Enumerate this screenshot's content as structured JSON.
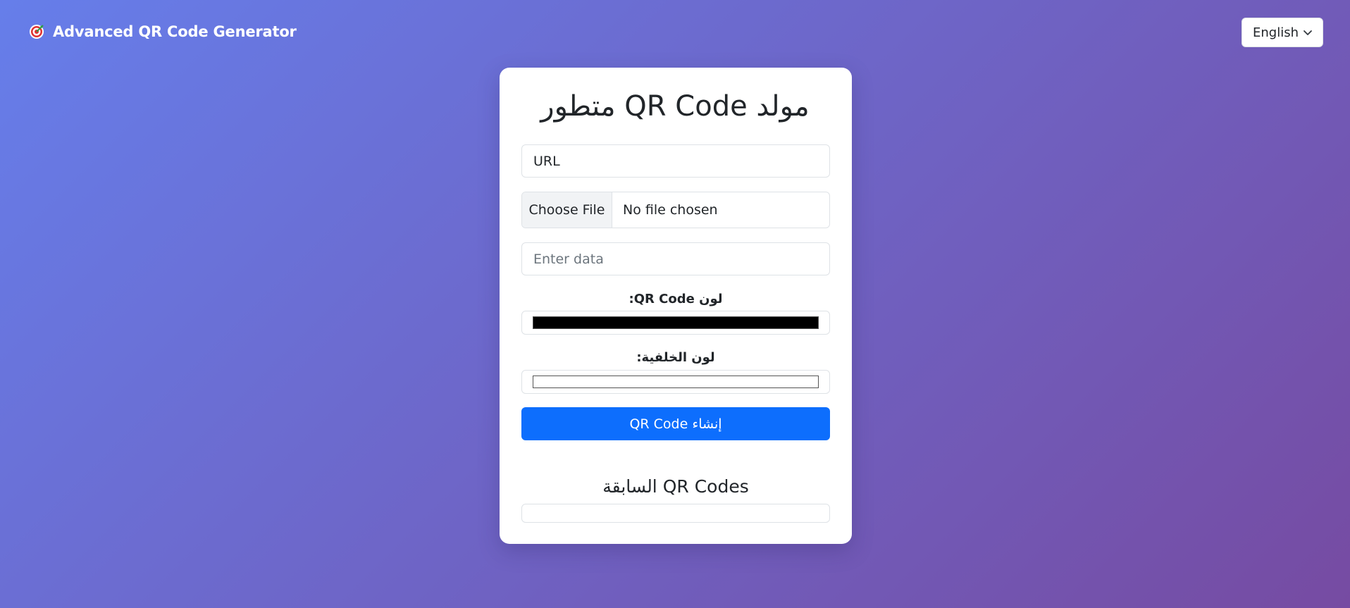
{
  "header": {
    "brand_icon": "target-icon",
    "brand_text": "Advanced QR Code Generator",
    "language_selected": "English"
  },
  "form": {
    "title": "مولد QR Code متطور",
    "url_value": "URL",
    "file_button_label": "Choose File",
    "file_status": "No file chosen",
    "data_placeholder": "Enter data",
    "qr_color_label": "لون QR Code:",
    "qr_color_value": "#000000",
    "bg_color_label": "لون الخلفية:",
    "bg_color_value": "#ffffff",
    "generate_label": "إنشاء QR Code",
    "generate_color": "#0d6efd"
  },
  "history": {
    "title": "QR Codes السابقة"
  }
}
